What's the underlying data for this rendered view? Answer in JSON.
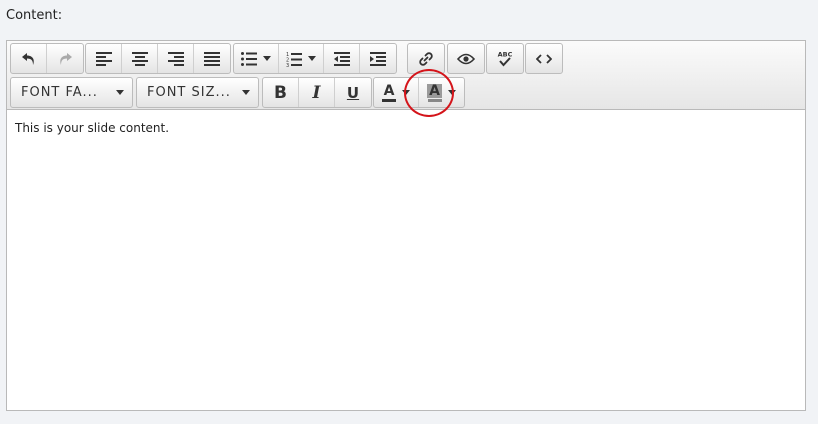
{
  "field": {
    "label": "Content:"
  },
  "toolbar": {
    "font_family_label": "FONT FA...",
    "font_size_label": "FONT SIZ...",
    "bold_label": "B",
    "italic_label": "I",
    "underline_label": "U",
    "text_color_label": "A",
    "bg_color_label": "A",
    "spellcheck_label": "ABC"
  },
  "editor": {
    "content": "This is your slide content."
  },
  "colors": {
    "highlight": "#d4141a",
    "text_color_bar": "#333333",
    "bg_color_bar": "#888888"
  }
}
